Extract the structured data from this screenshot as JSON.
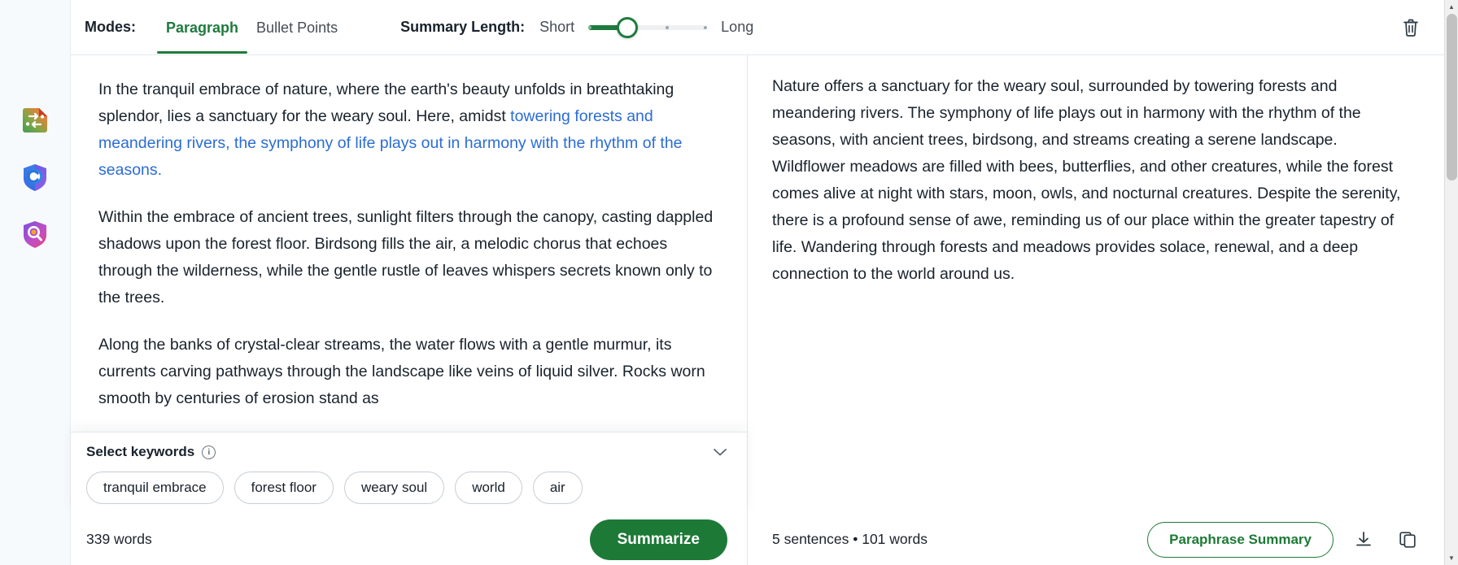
{
  "rail": {
    "items": [
      {
        "name": "paraphraser-tool",
        "icon": "paraphraser-document-icon"
      },
      {
        "name": "grammar-checker-tool",
        "icon": "grammar-shield-icon"
      },
      {
        "name": "plagiarism-checker-tool",
        "icon": "plagiarism-magnifier-icon"
      }
    ]
  },
  "toolbar": {
    "modes_label": "Modes:",
    "tabs": [
      {
        "label": "Paragraph",
        "active": true
      },
      {
        "label": "Bullet Points",
        "active": false
      }
    ],
    "summary_length_label": "Summary Length:",
    "short_label": "Short",
    "long_label": "Long",
    "slider_value_percent": 33,
    "delete_tooltip": "Delete",
    "accent_green": "#1f7a3e",
    "link_blue": "#2b6cd4"
  },
  "source": {
    "paragraphs": [
      {
        "pre": "In the tranquil embrace of nature, where the earth's beauty unfolds in breathtaking splendor, lies a sanctuary for the weary soul. Here, amidst ",
        "highlight": "towering forests and meandering rivers, the symphony of life plays out in harmony with the rhythm of the seasons.",
        "post": ""
      },
      {
        "pre": "Within the embrace of ancient trees, sunlight filters through the canopy, casting dappled shadows upon the forest floor. Birdsong fills the air, a melodic chorus that echoes through the wilderness, while the gentle rustle of leaves whispers secrets known only to the trees.",
        "highlight": "",
        "post": ""
      },
      {
        "pre": "Along the banks of crystal-clear streams, the water flows with a gentle murmur, its currents carving pathways through the landscape like veins of liquid silver. Rocks worn smooth by centuries of erosion stand as",
        "highlight": "",
        "post": ""
      }
    ],
    "word_count": "339 words",
    "summarize_label": "Summarize"
  },
  "keywords": {
    "title": "Select keywords",
    "info_glyph": "i",
    "collapse_icon": "chevron-down-icon",
    "chips": [
      "tranquil embrace",
      "forest floor",
      "weary soul",
      "world",
      "air"
    ]
  },
  "summary": {
    "text": "Nature offers a sanctuary for the weary soul, surrounded by towering forests and meandering rivers. The symphony of life plays out in harmony with the rhythm of the seasons, with ancient trees, birdsong, and streams creating a serene landscape. Wildflower meadows are filled with bees, butterflies, and other creatures, while the forest comes alive at night with stars, moon, owls, and nocturnal creatures. Despite the serenity, there is a profound sense of awe, reminding us of our place within the greater tapestry of life. Wandering through forests and meadows provides solace, renewal, and a deep connection to the world around us.",
    "meta": "5 sentences • 101 words",
    "paraphrase_label": "Paraphrase Summary",
    "download_icon": "download-icon",
    "copy_icon": "copy-icon"
  },
  "scrollbar": {
    "up_arrow": "▲",
    "down_arrow": "▼"
  }
}
